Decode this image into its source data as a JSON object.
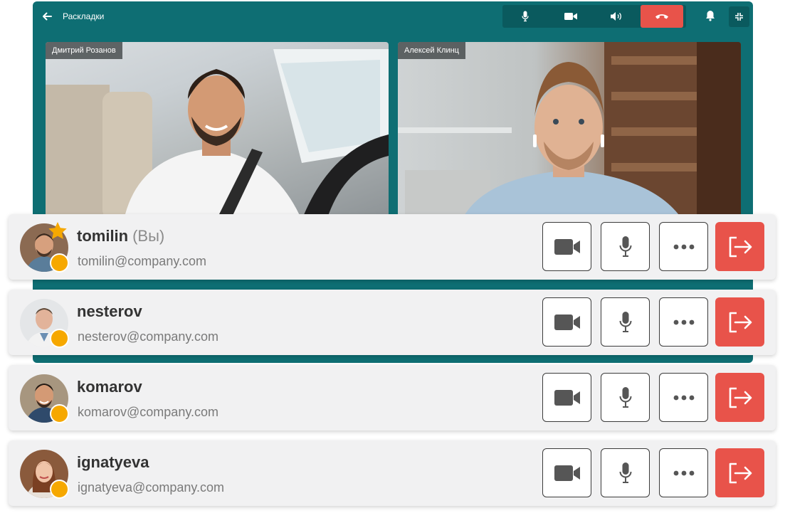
{
  "call": {
    "title": "Раскладки",
    "tiles": [
      {
        "name": "Дмитрий Розанов"
      },
      {
        "name": "Алексей Клинц"
      }
    ],
    "colors": {
      "header_bg": "#0e6e73",
      "hangup": "#e8534a",
      "status": "#f6a800"
    },
    "controls": [
      "microphone-icon",
      "camera-icon",
      "speaker-icon",
      "hangup-icon",
      "bell-icon",
      "shrink-icon"
    ]
  },
  "participants": [
    {
      "username": "tomilin",
      "you_label": "(Вы)",
      "email": "tomilin@company.com",
      "is_host": true
    },
    {
      "username": "nesterov",
      "email": "nesterov@company.com",
      "is_host": false
    },
    {
      "username": "komarov",
      "email": "komarov@company.com",
      "is_host": false
    },
    {
      "username": "ignatyeva",
      "email": "ignatyeva@company.com",
      "is_host": false
    }
  ]
}
